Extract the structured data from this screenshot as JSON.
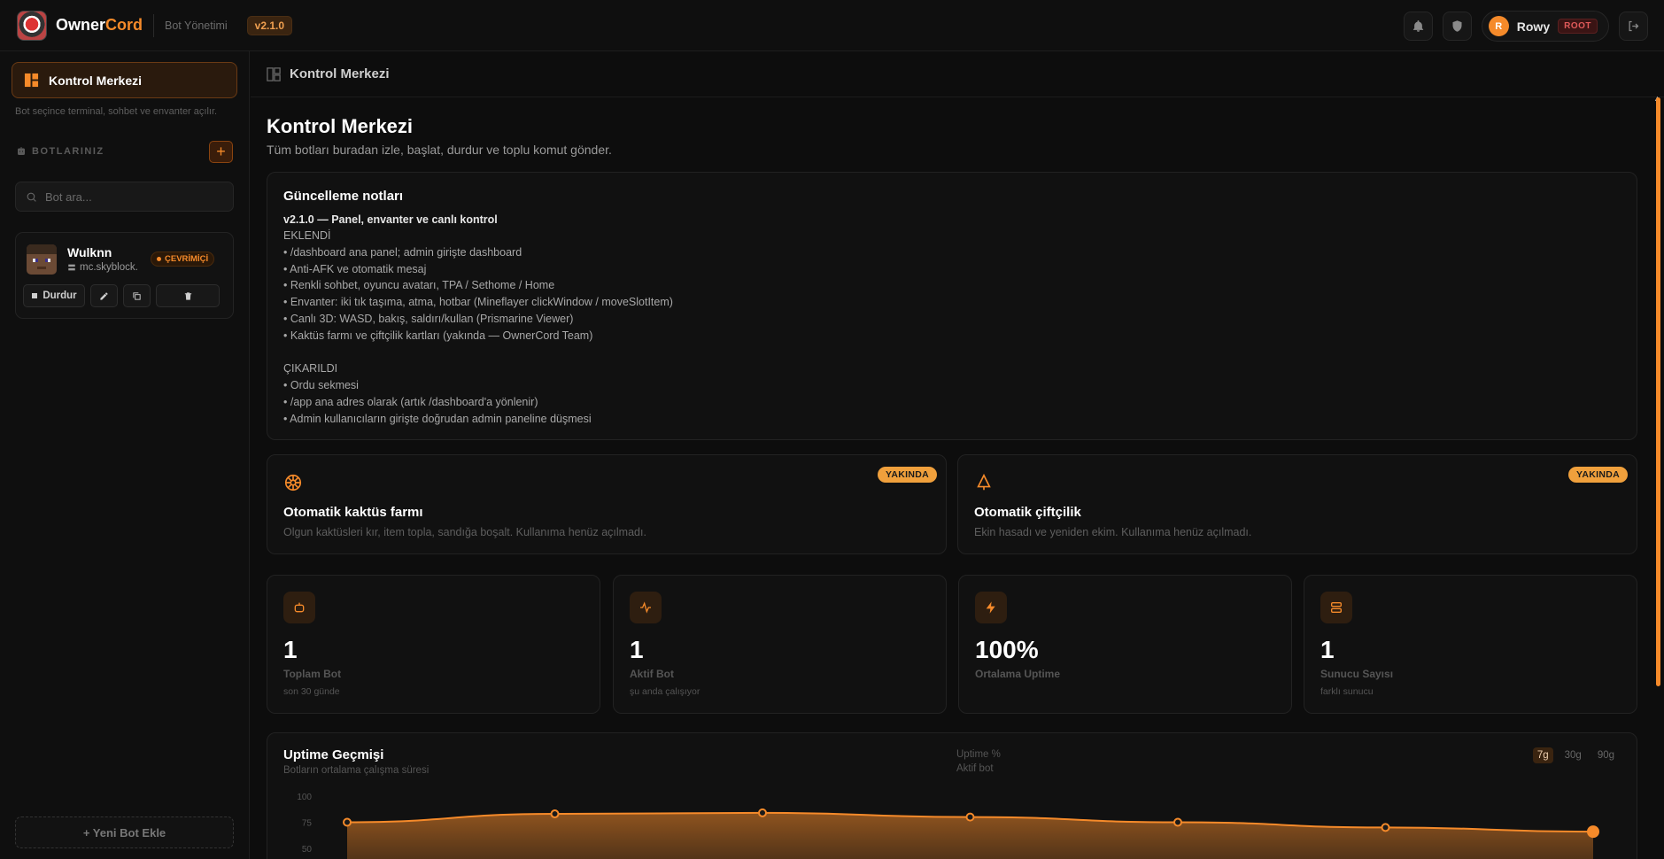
{
  "topbar": {
    "brand_main": "Owner",
    "brand_accent": "Cord",
    "subtitle": "Bot Yönetimi",
    "version": "v2.1.0",
    "user_initial": "R",
    "user_name": "Rowy",
    "role": "ROOT",
    "icons": [
      "bell-icon",
      "shield-icon",
      "logout-icon"
    ]
  },
  "sidebar": {
    "active_label": "Kontrol Merkezi",
    "hint": "Bot seçince terminal, sohbet ve envanter açılır.",
    "section_title": "BOTLARINIZ",
    "add_label": "+",
    "search_placeholder": "Bot ara...",
    "bots": [
      {
        "name": "Wulknn",
        "host": "mc.skyblock.",
        "status": "ÇEVRİMİÇİ",
        "stop_label": "Durdur"
      }
    ],
    "new_bot_label": "+ Yeni Bot Ekle"
  },
  "main": {
    "header_title": "Kontrol Merkezi",
    "title": "Kontrol Merkezi",
    "subtitle": "Tüm botları buradan izle, başlat, durdur ve toplu komut gönder.",
    "notes": {
      "title": "Güncelleme notları",
      "version_line": "v2.1.0 — Panel, envanter ve canlı kontrol",
      "lines": [
        "EKLENDİ",
        "• /dashboard ana panel; admin girişte dashboard",
        "• Anti-AFK ve otomatik mesaj",
        "• Renkli sohbet, oyuncu avatarı, TPA / Sethome / Home",
        "• Envanter: iki tık taşıma, atma, hotbar (Mineflayer clickWindow / moveSlotItem)",
        "• Canlı 3D: WASD, bakış, saldırı/kullan (Prismarine Viewer)",
        "• Kaktüs farmı ve çiftçilik kartları (yakında — OwnerCord Team)",
        "",
        "ÇIKARILDI",
        "• Ordu sekmesi",
        "• /app ana adres olarak (artık /dashboard'a yönlenir)",
        "• Admin kullanıcıların girişte doğrudan admin paneline düşmesi"
      ]
    },
    "features": [
      {
        "badge": "YAKINDA",
        "title": "Otomatik kaktüs farmı",
        "desc": "Olgun kaktüsleri kır, item topla, sandığa boşalt. Kullanıma henüz açılmadı.",
        "icon": "cactus-icon"
      },
      {
        "badge": "YAKINDA",
        "title": "Otomatik çiftçilik",
        "desc": "Ekin hasadı ve yeniden ekim. Kullanıma henüz açılmadı.",
        "icon": "sprout-icon"
      }
    ],
    "stats": [
      {
        "value": "1",
        "label": "Toplam Bot",
        "sub": "son 30 günde",
        "icon": "bot-icon"
      },
      {
        "value": "1",
        "label": "Aktif Bot",
        "sub": "şu anda çalışıyor",
        "icon": "activity-icon"
      },
      {
        "value": "100%",
        "label": "Ortalama Uptime",
        "sub": "",
        "icon": "bolt-icon"
      },
      {
        "value": "1",
        "label": "Sunucu Sayısı",
        "sub": "farklı sunucu",
        "icon": "server-icon"
      }
    ],
    "uptime": {
      "title": "Uptime Geçmişi",
      "subtitle": "Botların ortalama çalışma süresi",
      "legend": [
        "Uptime %",
        "Aktif bot"
      ],
      "ranges": [
        "7g",
        "30g",
        "90g"
      ],
      "active_range": "7g"
    }
  },
  "chart_data": {
    "type": "area",
    "title": "Uptime Geçmişi",
    "ylabel": "",
    "y_ticks": [
      "100",
      "75",
      "50"
    ],
    "series": [
      {
        "name": "Uptime %",
        "values": [
          75,
          83,
          84,
          80,
          75,
          70,
          66
        ]
      }
    ],
    "ylim": [
      50,
      100
    ],
    "accent": "#f58a2a"
  }
}
